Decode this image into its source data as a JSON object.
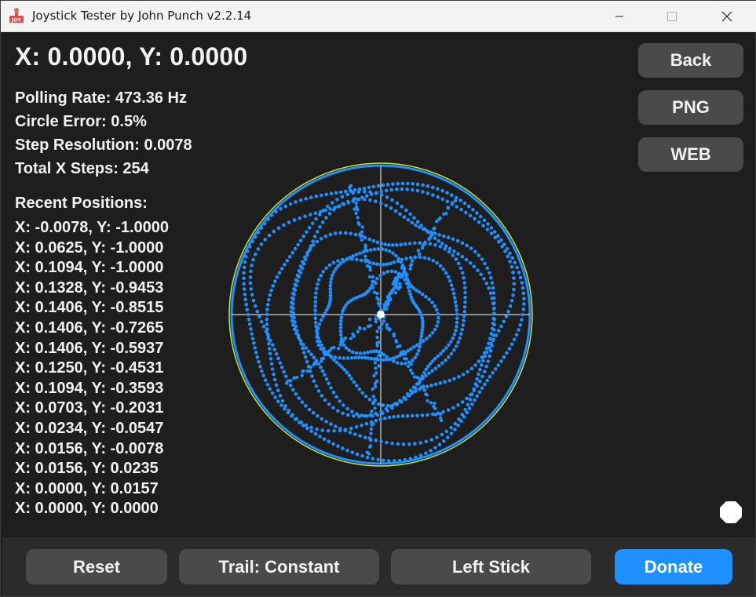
{
  "window": {
    "title": "Joystick Tester by John Punch v2.2.14",
    "icon_text": "JOY"
  },
  "header": {
    "coordinates": "X: 0.0000, Y: 0.0000"
  },
  "stats": {
    "polling_rate": "Polling Rate: 473.36 Hz",
    "circle_error": "Circle Error: 0.5%",
    "step_resolution": "Step Resolution: 0.0078",
    "total_x_steps": "Total X Steps: 254"
  },
  "recent": {
    "title": "Recent Positions:",
    "items": [
      "X: -0.0078, Y: -1.0000",
      "X: 0.0625, Y: -1.0000",
      "X: 0.1094, Y: -1.0000",
      "X: 0.1328, Y: -0.9453",
      "X: 0.1406, Y: -0.8515",
      "X: 0.1406, Y: -0.7265",
      "X: 0.1406, Y: -0.5937",
      "X: 0.1250, Y: -0.4531",
      "X: 0.1094, Y: -0.3593",
      "X: 0.0703, Y: -0.2031",
      "X: 0.0234, Y: -0.0547",
      "X: 0.0156, Y: -0.0078",
      "X: 0.0156, Y: 0.0235",
      "X: 0.0000, Y: 0.0157",
      "X: 0.0000, Y: 0.0000"
    ]
  },
  "side_buttons": {
    "back": "Back",
    "png": "PNG",
    "web": "WEB"
  },
  "bottom_buttons": {
    "reset": "Reset",
    "trail": "Trail: Constant",
    "stick": "Left Stick",
    "donate": "Donate"
  },
  "colors": {
    "trail": "#1e90ff",
    "boundary": "#c8e632",
    "donate": "#1e90ff",
    "button": "#4a4a4a"
  }
}
